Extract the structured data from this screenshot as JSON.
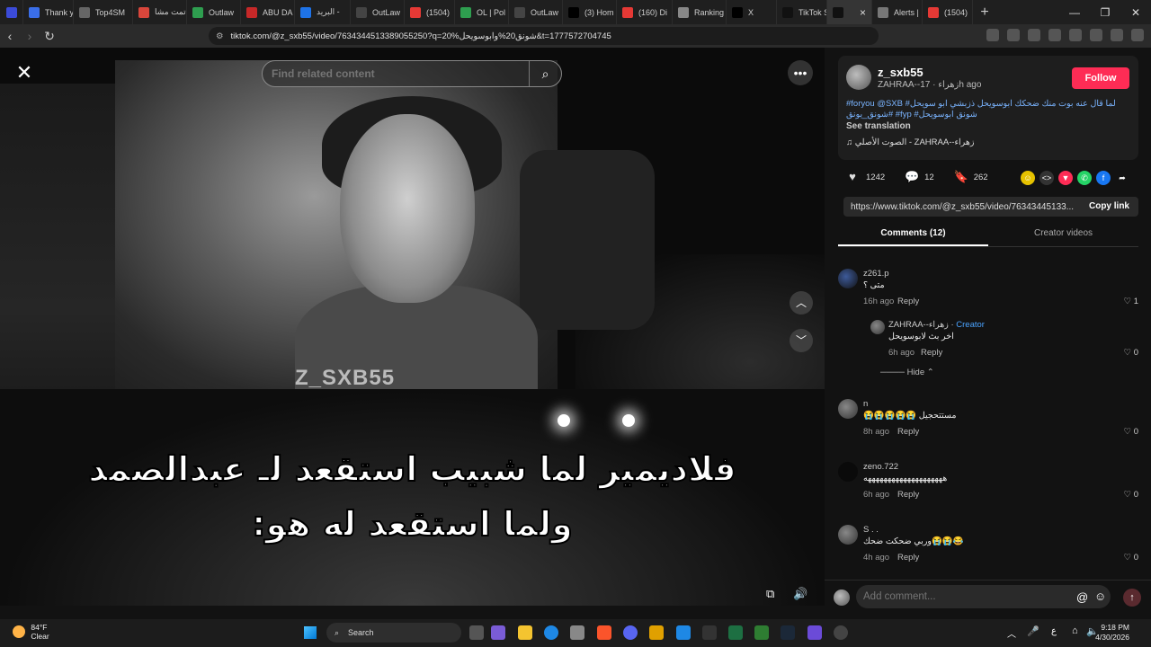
{
  "browser": {
    "tabs": [
      {
        "label": "Thank y",
        "color": "#3a6ee8"
      },
      {
        "label": "Top4SM",
        "color": "#666666"
      },
      {
        "label": "تمت مشا",
        "color": "#d9463b"
      },
      {
        "label": "Outlaw",
        "color": "#2e9e4f"
      },
      {
        "label": "ABU DA",
        "color": "#c62828"
      },
      {
        "label": "البريد - ",
        "color": "#1e73e8"
      },
      {
        "label": "OutLaw",
        "color": "#444444"
      },
      {
        "label": "(1504)",
        "color": "#e53935"
      },
      {
        "label": "OL | Pol",
        "color": "#2e9e4f"
      },
      {
        "label": "OutLaw",
        "color": "#444444"
      },
      {
        "label": "(3) Hom",
        "color": "#000000"
      },
      {
        "label": "(160) Di",
        "color": "#e53935"
      },
      {
        "label": "Ranking",
        "color": "#888888"
      },
      {
        "label": "X",
        "color": "#000000"
      },
      {
        "label": "TikTok S",
        "color": "#111111"
      },
      {
        "label": "",
        "color": "#111111"
      },
      {
        "label": "Alerts |",
        "color": "#777777"
      },
      {
        "label": "(1504)",
        "color": "#e53935"
      }
    ],
    "active_tab_index": 15,
    "url": "tiktok.com/@z_sxb55/video/7634344513389055250?q=20%شونق20%وابوسويحل&t=1777572704745"
  },
  "video": {
    "search_placeholder": "Find related content",
    "watermark": "Z_SXB55",
    "caption_line1": "فلاديمير لما شبيب استقعد لـ عبدالصمد",
    "caption_line2": "ولما استقعد له هو:"
  },
  "post": {
    "username": "z_sxb55",
    "subtitle": "ZAHRAA--زهراء · 17h ago",
    "follow_label": "Follow",
    "description": "#foryou @SXB لما قال عنه بوت منك ضحكك ابوسويحل ذزبشي ابو سويحل# شونق_يونق# #fyp #شونق ابوسويحل",
    "see_translation": "See translation",
    "music": "♫ الصوت الأصلي - ZAHRAA--زهراء",
    "likes": "1242",
    "comments_count": "12",
    "saves": "262",
    "link": "https://www.tiktok.com/@z_sxb55/video/76343445133...",
    "copy_label": "Copy link"
  },
  "tabs2": {
    "comments": "Comments (12)",
    "creator": "Creator videos"
  },
  "comments": [
    {
      "name": "z261.p",
      "text": "متى ؟",
      "time": "16h ago",
      "reply": "Reply",
      "likes": "1"
    },
    {
      "name": "ZAHRAA--زهراء · ",
      "badge": "Creator",
      "text": "اخر بث لابوسويحل",
      "time": "6h ago",
      "reply": "Reply",
      "likes": "0"
    },
    {
      "name": "n",
      "text": "😭😭😭😭😭 مستتحجيل",
      "time": "8h ago",
      "reply": "Reply",
      "likes": "0"
    },
    {
      "name": "zeno.722",
      "text": "ههههههههههههههههههههه",
      "time": "6h ago",
      "reply": "Reply",
      "likes": "0"
    },
    {
      "name": "S . .",
      "text": "وربي ضحكت ضحك😭😭😂",
      "time": "4h ago",
      "reply": "Reply",
      "likes": "0"
    }
  ],
  "hide_label": "Hide",
  "add_comment_placeholder": "Add comment...",
  "taskbar": {
    "temp": "84°F",
    "weather": "Clear",
    "search": "Search",
    "lang": "ع",
    "time": "9:18 PM",
    "date": "4/30/2026"
  },
  "colors": {
    "accent": "#fe2c55",
    "link_blue": "#7ab4ff",
    "creator_blue": "#4aa3ff"
  }
}
